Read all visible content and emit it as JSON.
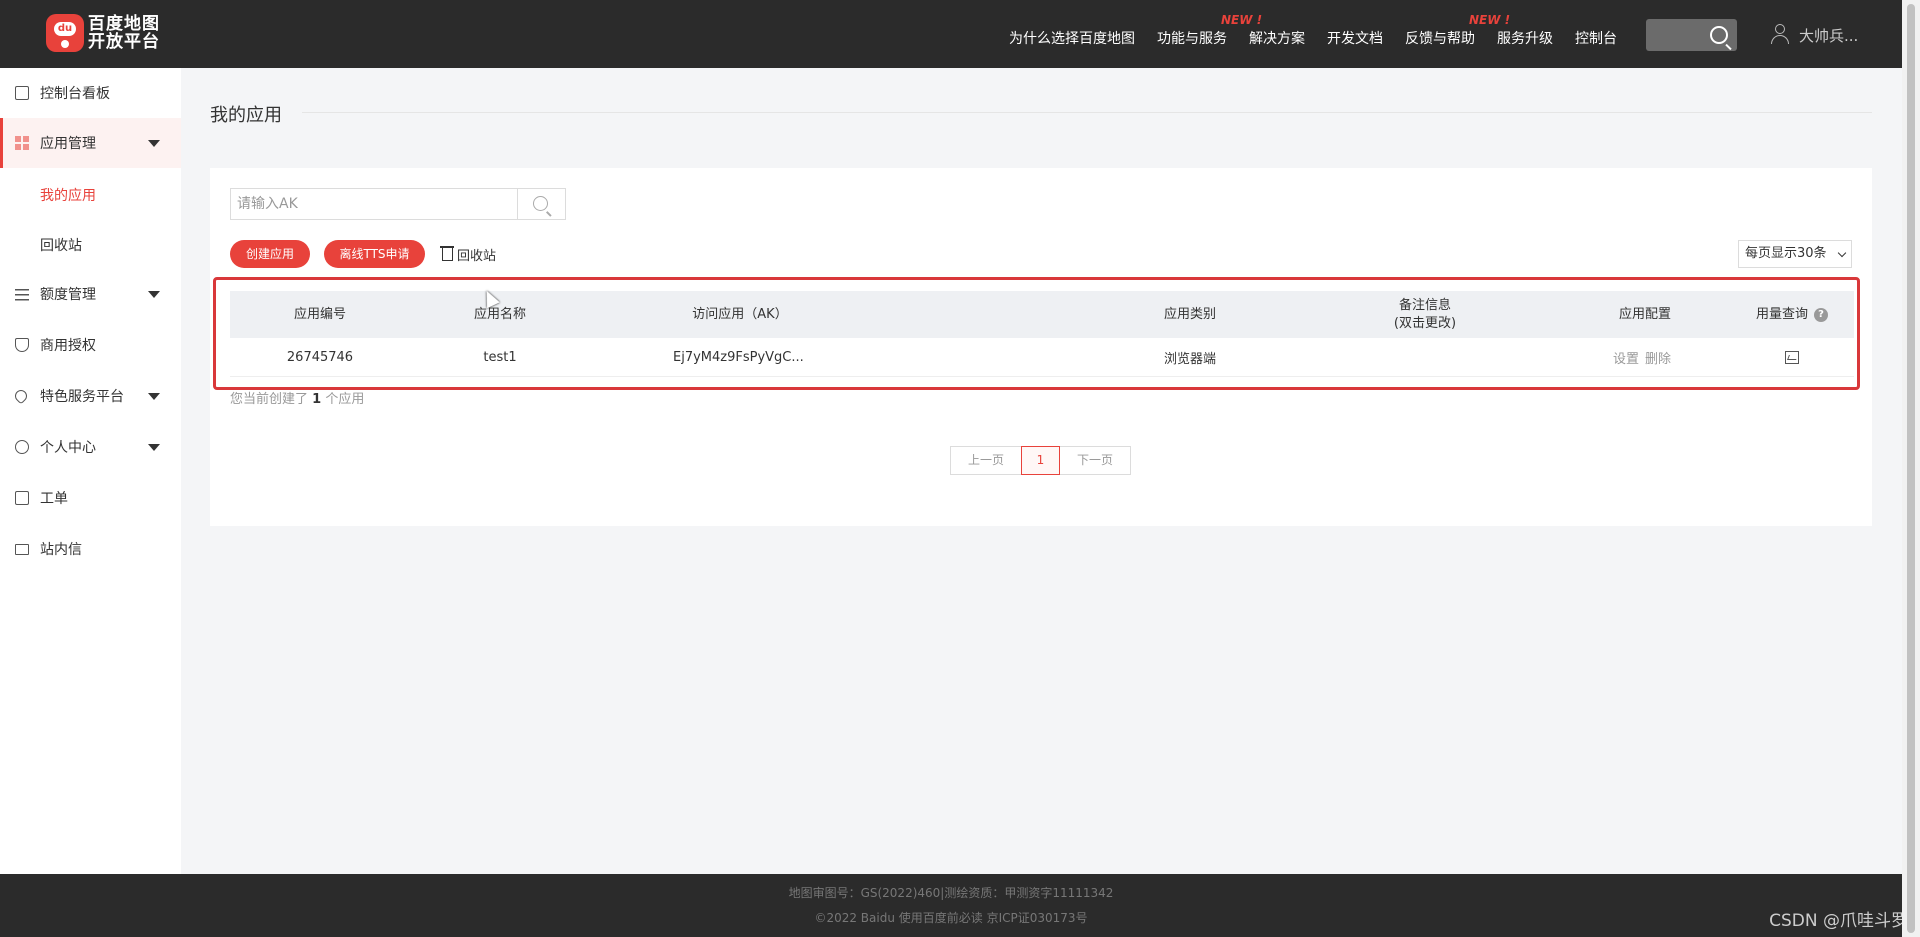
{
  "header": {
    "logo_line1": "百度地图",
    "logo_line2": "开放平台",
    "logo_badge": "du",
    "nav": [
      {
        "label": "为什么选择百度地图"
      },
      {
        "label": "功能与服务",
        "badge": "NEW !"
      },
      {
        "label": "解决方案"
      },
      {
        "label": "开发文档"
      },
      {
        "label": "反馈与帮助",
        "badge": "NEW !"
      },
      {
        "label": "服务升级"
      },
      {
        "label": "控制台"
      }
    ],
    "user_name": "大帅兵..."
  },
  "sidebar": {
    "items": [
      {
        "label": "控制台看板",
        "icon": "dashboard-icon"
      },
      {
        "label": "应用管理",
        "icon": "grid-icon",
        "expanded": true
      },
      {
        "label": "额度管理",
        "icon": "sliders-icon"
      },
      {
        "label": "商用授权",
        "icon": "shield-icon"
      },
      {
        "label": "特色服务平台",
        "icon": "heart-icon"
      },
      {
        "label": "个人中心",
        "icon": "user-icon"
      },
      {
        "label": "工单",
        "icon": "clipboard-icon"
      },
      {
        "label": "站内信",
        "icon": "mail-icon"
      }
    ],
    "sub_items": [
      {
        "label": "我的应用"
      },
      {
        "label": "回收站"
      }
    ]
  },
  "main": {
    "title": "我的应用",
    "search_placeholder": "请输入AK",
    "create_button": "创建应用",
    "tts_button": "离线TTS申请",
    "trash_link": "回收站",
    "per_page": "每页显示30条",
    "columns": [
      "应用编号",
      "应用名称",
      "访问应用（AK）",
      "应用类别",
      "备注信息",
      "(双击更改)",
      "应用配置",
      "用量查询"
    ],
    "rows": [
      {
        "id": "26745746",
        "name": "test1",
        "ak": "Ej7yM4z9FsPyVgC...",
        "category": "浏览器端",
        "note": "",
        "op_settings": "设置",
        "op_delete": "删除"
      }
    ],
    "count_prefix": "您当前创建了",
    "count_value": "1",
    "count_suffix": "个应用",
    "pager": {
      "prev": "上一页",
      "current": "1",
      "next": "下一页"
    }
  },
  "footer": {
    "line1": "地图审图号：GS(2022)460|测绘资质：甲测资字11111342",
    "line2": "©2022 Baidu 使用百度前必读 京ICP证030173号"
  },
  "watermark": "CSDN @爪哇斗罗",
  "colors": {
    "accent": "#e8423b",
    "header_bg": "#2b2b2b",
    "highlight": "#d9383a"
  }
}
